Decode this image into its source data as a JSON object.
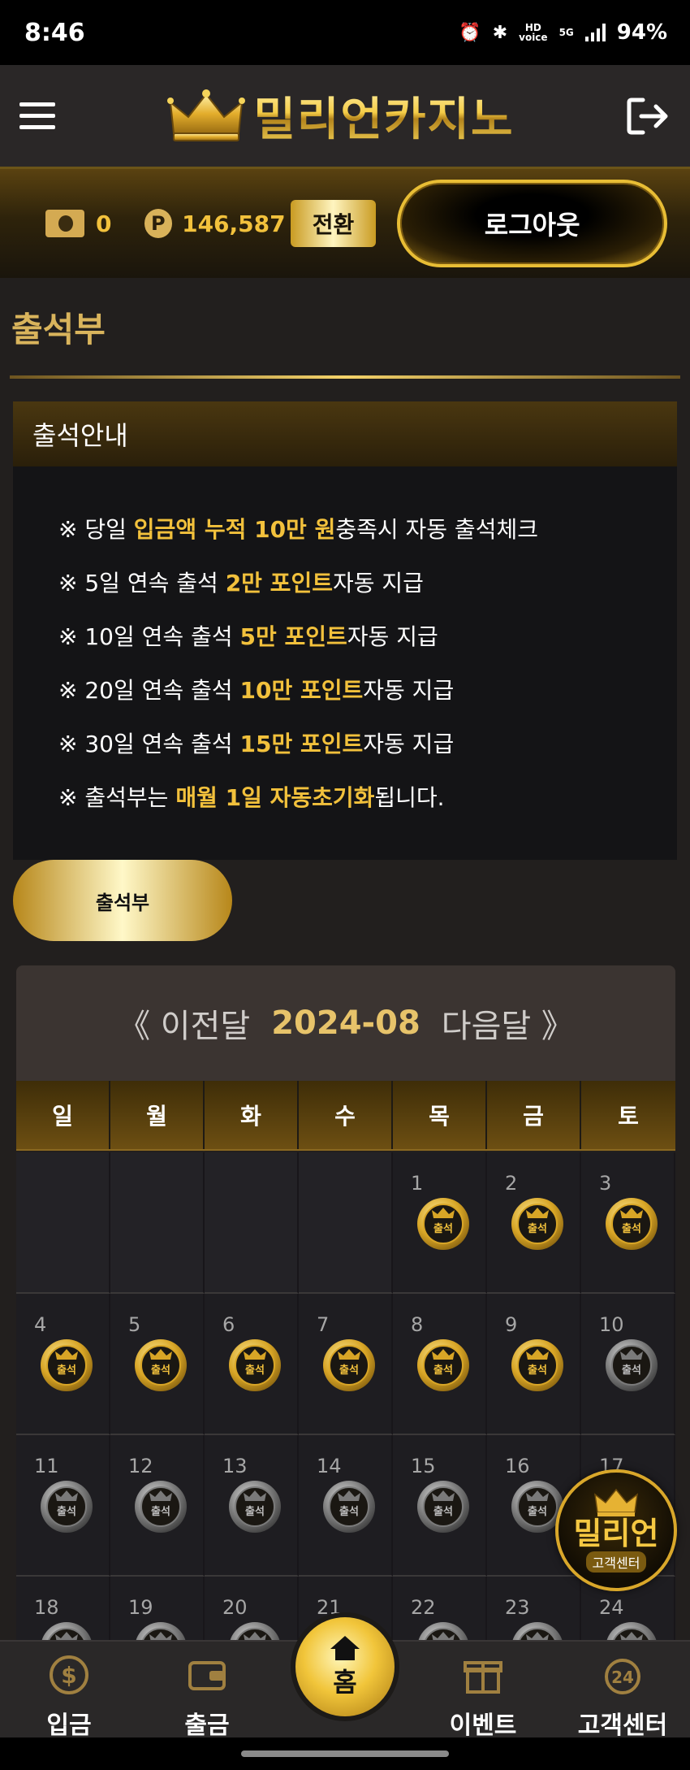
{
  "status_bar": {
    "time": "8:46",
    "network": "5G",
    "battery": "94%"
  },
  "header": {
    "logo_text": "밀리언카지노"
  },
  "wallet": {
    "money_value": "0",
    "point_symbol": "P",
    "point_value": "146,587",
    "convert_label": "전환",
    "logout_label": "로그아웃"
  },
  "page": {
    "title": "출석부",
    "info_title": "출석안내"
  },
  "info_lines": [
    {
      "prefix": "※ 당일 ",
      "highlight": "입금액 누적 10만 원",
      "suffix": "충족시 자동 출석체크"
    },
    {
      "prefix": "※ 5일 연속 출석 ",
      "highlight": "2만 포인트",
      "suffix": "자동 지급"
    },
    {
      "prefix": "※ 10일 연속 출석 ",
      "highlight": "5만 포인트",
      "suffix": "자동 지급"
    },
    {
      "prefix": "※ 20일 연속 출석 ",
      "highlight": "10만 포인트",
      "suffix": "자동 지급"
    },
    {
      "prefix": "※ 30일 연속 출석 ",
      "highlight": "15만 포인트",
      "suffix": "자동 지급"
    },
    {
      "prefix": "※ 출석부는 ",
      "highlight": "매월 1일 자동초기화",
      "suffix": "됩니다."
    }
  ],
  "attend_button_label": "출석부",
  "calendar": {
    "prev_label": "《 이전달",
    "month": "2024-08",
    "next_label": "다음달 》",
    "weekdays": [
      "일",
      "월",
      "화",
      "수",
      "목",
      "금",
      "토"
    ],
    "stamp_label": "출석",
    "days": [
      {
        "day": "",
        "attended": false
      },
      {
        "day": "",
        "attended": false
      },
      {
        "day": "",
        "attended": false
      },
      {
        "day": "",
        "attended": false
      },
      {
        "day": "1",
        "attended": true
      },
      {
        "day": "2",
        "attended": true
      },
      {
        "day": "3",
        "attended": true
      },
      {
        "day": "4",
        "attended": true
      },
      {
        "day": "5",
        "attended": true
      },
      {
        "day": "6",
        "attended": true
      },
      {
        "day": "7",
        "attended": true
      },
      {
        "day": "8",
        "attended": true
      },
      {
        "day": "9",
        "attended": true
      },
      {
        "day": "10",
        "attended": false
      },
      {
        "day": "11",
        "attended": false
      },
      {
        "day": "12",
        "attended": false
      },
      {
        "day": "13",
        "attended": false
      },
      {
        "day": "14",
        "attended": false
      },
      {
        "day": "15",
        "attended": false
      },
      {
        "day": "16",
        "attended": false
      },
      {
        "day": "17",
        "attended": false
      },
      {
        "day": "18",
        "attended": false
      },
      {
        "day": "19",
        "attended": false
      },
      {
        "day": "20",
        "attended": false
      },
      {
        "day": "21",
        "attended": false
      },
      {
        "day": "22",
        "attended": false
      },
      {
        "day": "23",
        "attended": false
      },
      {
        "day": "24",
        "attended": false
      }
    ]
  },
  "support_badge": {
    "name": "밀리언",
    "sub": "고객센터"
  },
  "bottom_nav": {
    "deposit": "입금",
    "withdraw": "출금",
    "home": "홈",
    "event": "이벤트",
    "support": "고객센터"
  },
  "colors": {
    "gold": "#f2c13c",
    "background": "#221f1e",
    "silver_stamp": "#8c8c8c"
  }
}
